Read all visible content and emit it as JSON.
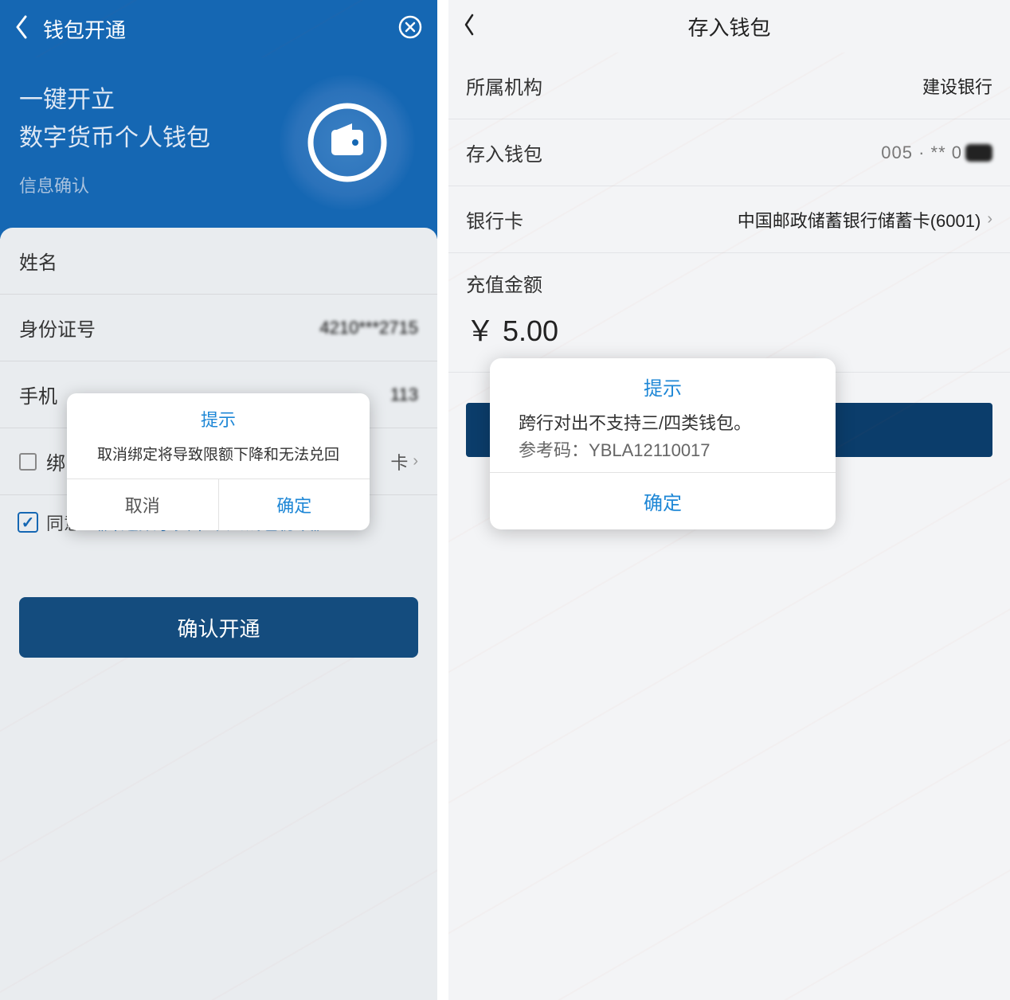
{
  "left": {
    "header": {
      "title": "钱包开通"
    },
    "hero": {
      "line1": "一键开立",
      "line2": "数字货币个人钱包",
      "subtitle": "信息确认"
    },
    "rows": {
      "name_label": "姓名",
      "id_label": "身份证号",
      "id_value": "4210***2715",
      "phone_label": "手机",
      "phone_value": "113",
      "card_label": "绑",
      "card_value": "卡"
    },
    "agree": {
      "prefix": "同意",
      "link": "《开通数字货币个人钱包协议》"
    },
    "submit": "确认开通",
    "dialog": {
      "title": "提示",
      "message": "取消绑定将导致限额下降和无法兑回",
      "cancel": "取消",
      "ok": "确定"
    }
  },
  "right": {
    "header": {
      "title": "存入钱包"
    },
    "rows": {
      "org_label": "所属机构",
      "org_value": "建设银行",
      "wallet_label": "存入钱包",
      "wallet_value": "005 · ** 0",
      "bank_label": "银行卡",
      "bank_value": "中国邮政储蓄银行储蓄卡(6001)"
    },
    "amount_label": "充值金额",
    "amount_value": "￥ 5.00",
    "dialog": {
      "title": "提示",
      "msg_line1": "跨行对出不支持三/四类钱包。",
      "ref_label": "参考码：",
      "ref_code": "YBLA12110017",
      "ok": "确定"
    }
  },
  "colors": {
    "primary_blue": "#1567b3",
    "dark_button": "#144c7e",
    "link_blue": "#1e87d6"
  }
}
